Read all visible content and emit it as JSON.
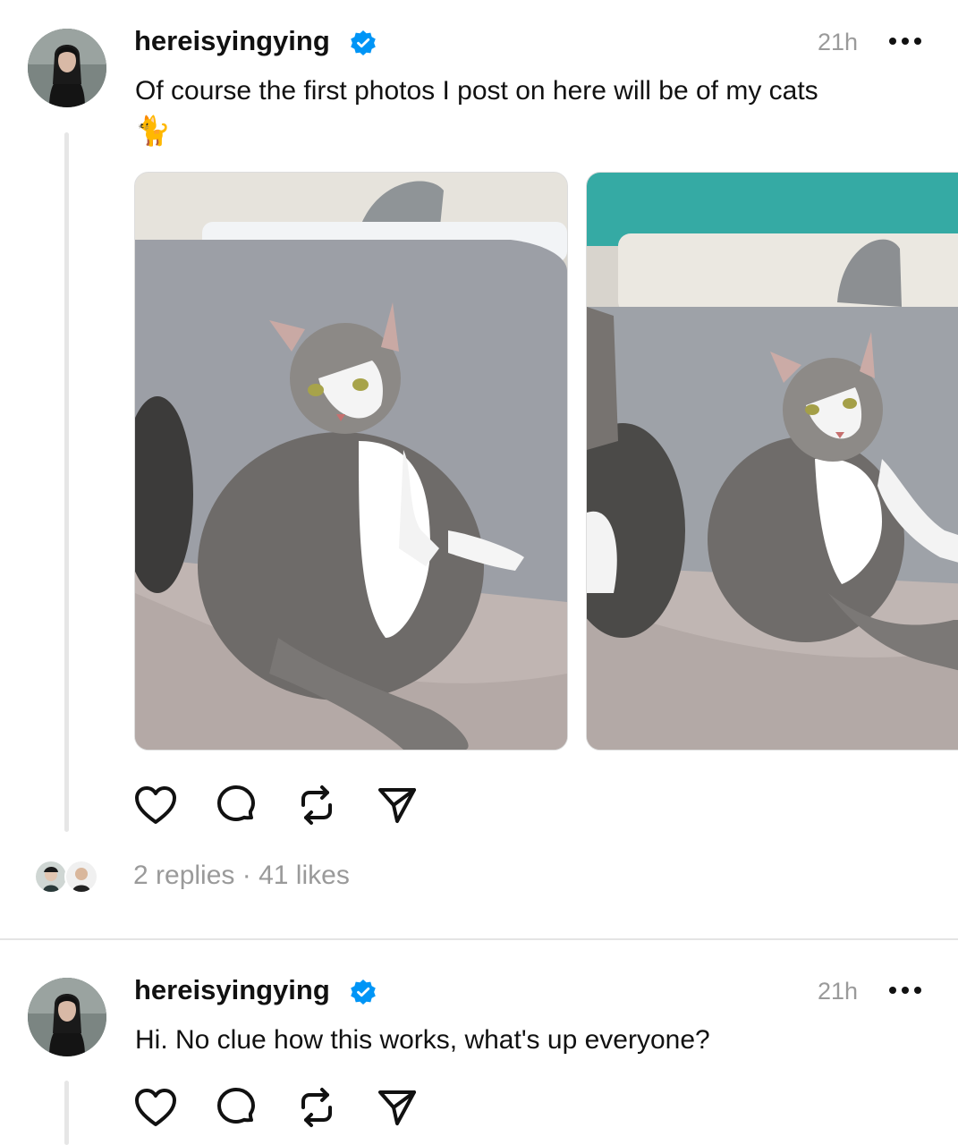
{
  "posts": [
    {
      "username": "hereisyingying",
      "time": "21h",
      "caption": "Of course the first photos I post on here will be of my cats",
      "caption_emoji": "🐈",
      "photos": [
        "cat-photo-1",
        "cat-photo-2"
      ],
      "replies_text": "2 replies",
      "separator": "·",
      "likes_text": "41 likes"
    },
    {
      "username": "hereisyingying",
      "time": "21h",
      "caption": "Hi. No clue how this works, what's up everyone?"
    }
  ],
  "icons": {
    "verified": "verified-badge-icon",
    "like": "heart-icon",
    "reply": "comment-bubble-icon",
    "repost": "repost-icon",
    "share": "send-icon",
    "more": "more-dots-icon"
  },
  "colors": {
    "verified": "#0095f6",
    "muted_text": "#9a9a9a",
    "thread_line": "#e6e6e6"
  }
}
